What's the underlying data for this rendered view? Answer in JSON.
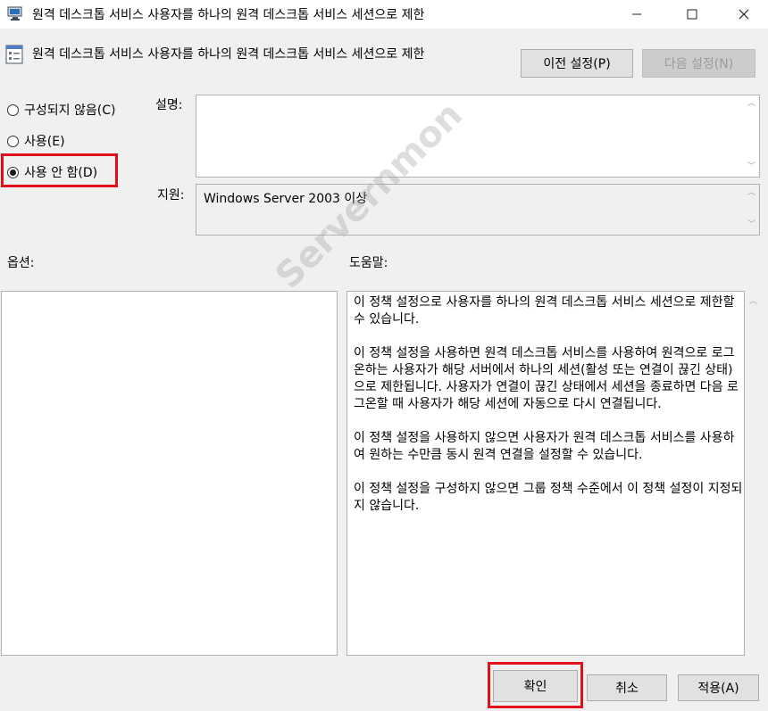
{
  "window": {
    "title": "원격 데스크톱 서비스 사용자를 하나의 원격 데스크톱 서비스 세션으로 제한"
  },
  "header": {
    "title": "원격 데스크톱 서비스 사용자를 하나의 원격 데스크톱 서비스 세션으로 제한",
    "prev_label": "이전 설정(P)",
    "next_label": "다음 설정(N)"
  },
  "radios": {
    "not_configured": "구성되지 않음(C)",
    "enabled": "사용(E)",
    "disabled": "사용 안 함(D)",
    "selected": "disabled"
  },
  "labels": {
    "description": "설명:",
    "supported": "지원:",
    "options": "옵션:",
    "help": "도움말:"
  },
  "supported_text": "Windows Server 2003 이상",
  "help_text": "이 정책 설정으로 사용자를 하나의 원격 데스크톱 서비스 세션으로 제한할 수 있습니다.\n\n이 정책 설정을 사용하면 원격 데스크톱 서비스를 사용하여 원격으로 로그온하는 사용자가 해당 서버에서 하나의 세션(활성 또는 연결이 끊긴 상태)으로 제한됩니다. 사용자가 연결이 끊긴 상태에서 세션을 종료하면 다음 로그온할 때 사용자가 해당 세션에 자동으로 다시 연결됩니다.\n\n이 정책 설정을 사용하지 않으면 사용자가 원격 데스크톱 서비스를 사용하여 원하는 수만큼 동시 원격 연결을 설정할 수 있습니다.\n\n이 정책 설정을 구성하지 않으면 그룹 정책 수준에서 이 정책 설정이 지정되지 않습니다.",
  "buttons": {
    "ok": "확인",
    "cancel": "취소",
    "apply": "적용(A)"
  },
  "watermark": "Servernmon",
  "colors": {
    "highlight": "#e0101a"
  }
}
